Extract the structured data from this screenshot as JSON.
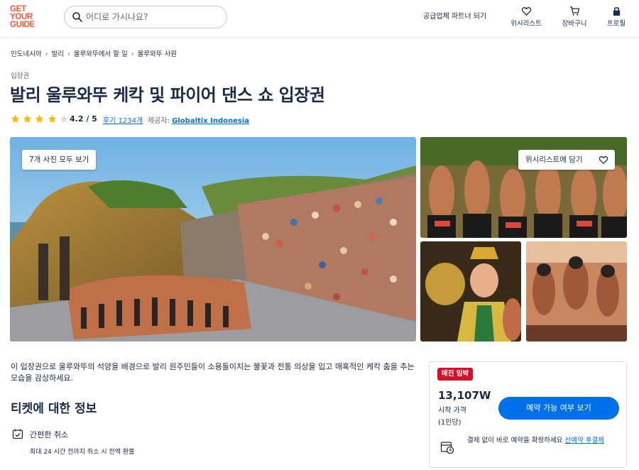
{
  "header": {
    "logo_lines": [
      "GET",
      "YOUR",
      "GUIDE"
    ],
    "search_placeholder": "어디로 가시나요?",
    "supplier_link": "공급업체 파트너 되기",
    "wishlist_label": "위시리스트",
    "cart_label": "장바구니",
    "profile_label": "프로필"
  },
  "breadcrumb": [
    "인도네시아",
    "발리",
    "울루와뚜에서 할 일",
    "울루와뚜 사원"
  ],
  "product": {
    "category": "입장권",
    "title": "발리 울루와뚜 케칵 및 파이어 댄스 쇼 입장권",
    "rating_value": 4.2,
    "rating_text": "4.2 / 5",
    "reviews_link": "후기 1234개",
    "provider_label": "제공자:",
    "provider_name": "Globaltix Indonesia"
  },
  "gallery": {
    "all_photos_button": "7개 사진 모두 보기",
    "wishlist_button": "위시리스트에 담기"
  },
  "description": "이 입장권으로 울루와뚜의 석양을 배경으로 발리 원주민들이 소용돌이치는 불꽃과 전통 의상을 입고 매혹적인 케칵 춤을 추는 모습을 감상하세요.",
  "ticket_info": {
    "section_title": "티켓에 대한 정보",
    "feature_title": "간편한 취소",
    "feature_subtitle": "최대 24 시간 전까지 취소 시 전액 환불"
  },
  "booking": {
    "badge": "매진 임박",
    "price": "13,107W",
    "price_label": "시작 가격",
    "price_unit": "(1인당)",
    "check_button": "예약 가능 여부 보기",
    "reserve_text": "결제 없이 바로 예약을 확정하세요",
    "reserve_link": "선예약 후결제"
  },
  "colors": {
    "brand": "#ff5533",
    "primary": "#0071eb",
    "text": "#1a2b49",
    "badge": "#d6102b",
    "star": "#ffb800"
  }
}
